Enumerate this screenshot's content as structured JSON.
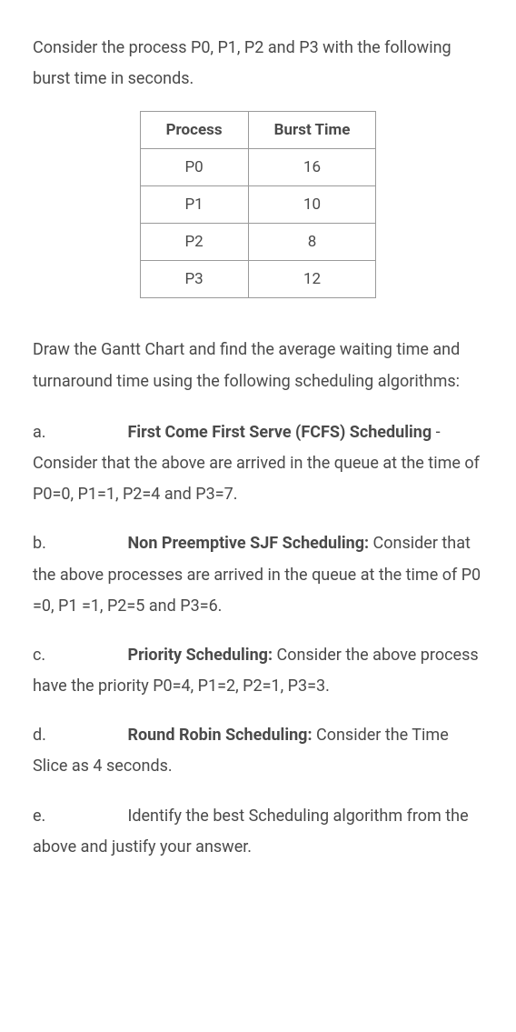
{
  "intro": "Consider the process P0, P1, P2 and P3 with the following burst time in seconds.",
  "table": {
    "headers": [
      "Process",
      "Burst Time"
    ],
    "rows": [
      {
        "process": "P0",
        "burst": "16"
      },
      {
        "process": "P1",
        "burst": "10"
      },
      {
        "process": "P2",
        "burst": "8"
      },
      {
        "process": "P3",
        "burst": "12"
      }
    ]
  },
  "instruction": "Draw the Gantt Chart and find the average waiting time and turnaround time using the following scheduling algorithms:",
  "items": {
    "a": {
      "label": "a.",
      "title": "First Come First Serve (FCFS) Scheduling",
      "rest": " - Consider that the above are arrived in the queue at the time of P0=0, P1=1, P2=4 and P3=7."
    },
    "b": {
      "label": "b.",
      "title": "Non Preemptive SJF Scheduling:",
      "rest": " Consider that the above processes are arrived in the queue at the time of P0 =0, P1 =1, P2=5 and P3=6."
    },
    "c": {
      "label": "c.",
      "title": "Priority Scheduling:",
      "rest": " Consider the above process have the priority P0=4, P1=2, P2=1, P3=3."
    },
    "d": {
      "label": "d.",
      "title": "Round Robin Scheduling:",
      "rest": " Consider the Time Slice as 4 seconds."
    },
    "e": {
      "label": "e.",
      "title": "",
      "rest": "Identify the best Scheduling algorithm from the above and justify your answer."
    }
  }
}
